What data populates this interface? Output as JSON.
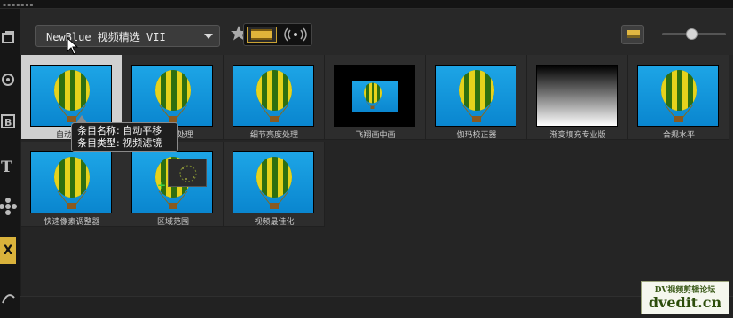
{
  "toolbar": {
    "library_dropdown_value": "NewBlue 视频精选 VII",
    "add_favorite_icon": "star-plus-icon",
    "video_filter_icon": "film-strip-icon",
    "audio_filter_icon": "audio-wave-icon",
    "layout_icon": "layout-icon",
    "zoom_level": 0.45
  },
  "sidebar": {
    "items": [
      {
        "icon": "media-library-icon"
      },
      {
        "icon": "instant-project-icon"
      },
      {
        "icon": "transition-icon",
        "label": "B"
      },
      {
        "icon": "title-icon",
        "label": "T"
      },
      {
        "icon": "graphics-icon"
      },
      {
        "icon": "filter-icon",
        "label": "FX",
        "active": true
      },
      {
        "icon": "path-icon"
      }
    ],
    "accent_color": "#d9b23b"
  },
  "filters": [
    {
      "name": "自动平移",
      "thumb": "balloon",
      "selected": true
    },
    {
      "name": "自动化处理",
      "thumb": "balloon"
    },
    {
      "name": "细节亮度处理",
      "thumb": "balloon"
    },
    {
      "name": "飞翔画中画",
      "thumb": "pip"
    },
    {
      "name": "伽玛校正器",
      "thumb": "balloon"
    },
    {
      "name": "渐变填充专业版",
      "thumb": "gradient"
    },
    {
      "name": "合规水平",
      "thumb": "balloon"
    },
    {
      "name": "快速像素调整器",
      "thumb": "balloon"
    },
    {
      "name": "区域范围",
      "thumb": "region"
    },
    {
      "name": "视频最佳化",
      "thumb": "balloon"
    }
  ],
  "tooltip": {
    "line1": "条目名称: 自动平移",
    "line2": "条目类型: 视频滤镜"
  },
  "watermark": {
    "line1": "DV视频剪辑论坛",
    "line2": "dvedit.cn"
  }
}
